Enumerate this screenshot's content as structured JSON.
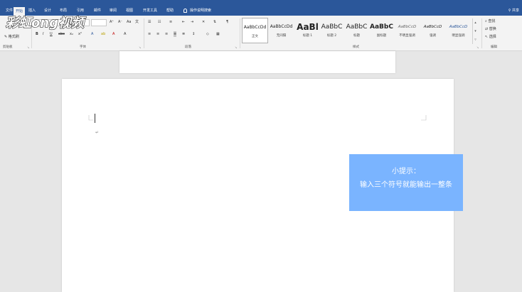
{
  "tabs": [
    {
      "label": "文件"
    },
    {
      "label": "开始"
    },
    {
      "label": "插入"
    },
    {
      "label": "设计"
    },
    {
      "label": "布局"
    },
    {
      "label": "引用"
    },
    {
      "label": "邮件"
    },
    {
      "label": "审阅"
    },
    {
      "label": "视图"
    },
    {
      "label": "开发工具"
    },
    {
      "label": "帮助"
    }
  ],
  "tell_me": "操作说明搜索",
  "share_label": "共享",
  "logo_text": "彩虹ong视频",
  "ribbon": {
    "clipboard": {
      "label": "剪贴板",
      "paste_label": "粘贴",
      "format_painter": "格式刷"
    },
    "font": {
      "label": "字体",
      "font_name": "",
      "font_size": "",
      "bold": "B",
      "italic": "I",
      "underline": "U",
      "strike": "abc",
      "sub": "x₂",
      "sup": "x²",
      "grow": "A⁺",
      "shrink": "A⁻",
      "clear": "Aa",
      "phonetic": "文",
      "border": "A"
    },
    "paragraph": {
      "label": "段落"
    },
    "styles": {
      "label": "样式",
      "items": [
        {
          "preview": "AaBbCcDd",
          "name": "正文"
        },
        {
          "preview": "AaBbCcDd",
          "name": "无间隔"
        },
        {
          "preview": "AaBl",
          "name": "标题 1"
        },
        {
          "preview": "AaBbC",
          "name": "标题 2"
        },
        {
          "preview": "AaBbC",
          "name": "标题"
        },
        {
          "preview": "AaBbC",
          "name": "副标题"
        },
        {
          "preview": "AaBbCcD",
          "name": "不明显强调"
        },
        {
          "preview": "AaBbCcD",
          "name": "强调"
        },
        {
          "preview": "AaBbCcD",
          "name": "明显强调"
        }
      ]
    },
    "editing": {
      "label": "编辑",
      "find": "查找",
      "replace": "替换",
      "select": "选择"
    }
  },
  "tip": {
    "title": "小提示：",
    "body": "输入三个符号就能输出一整条"
  },
  "colors": {
    "ribbon_blue": "#2b579a",
    "tip_blue": "#7ab4ff",
    "page": "#ffffff",
    "canvas": "#e6e6e6"
  }
}
